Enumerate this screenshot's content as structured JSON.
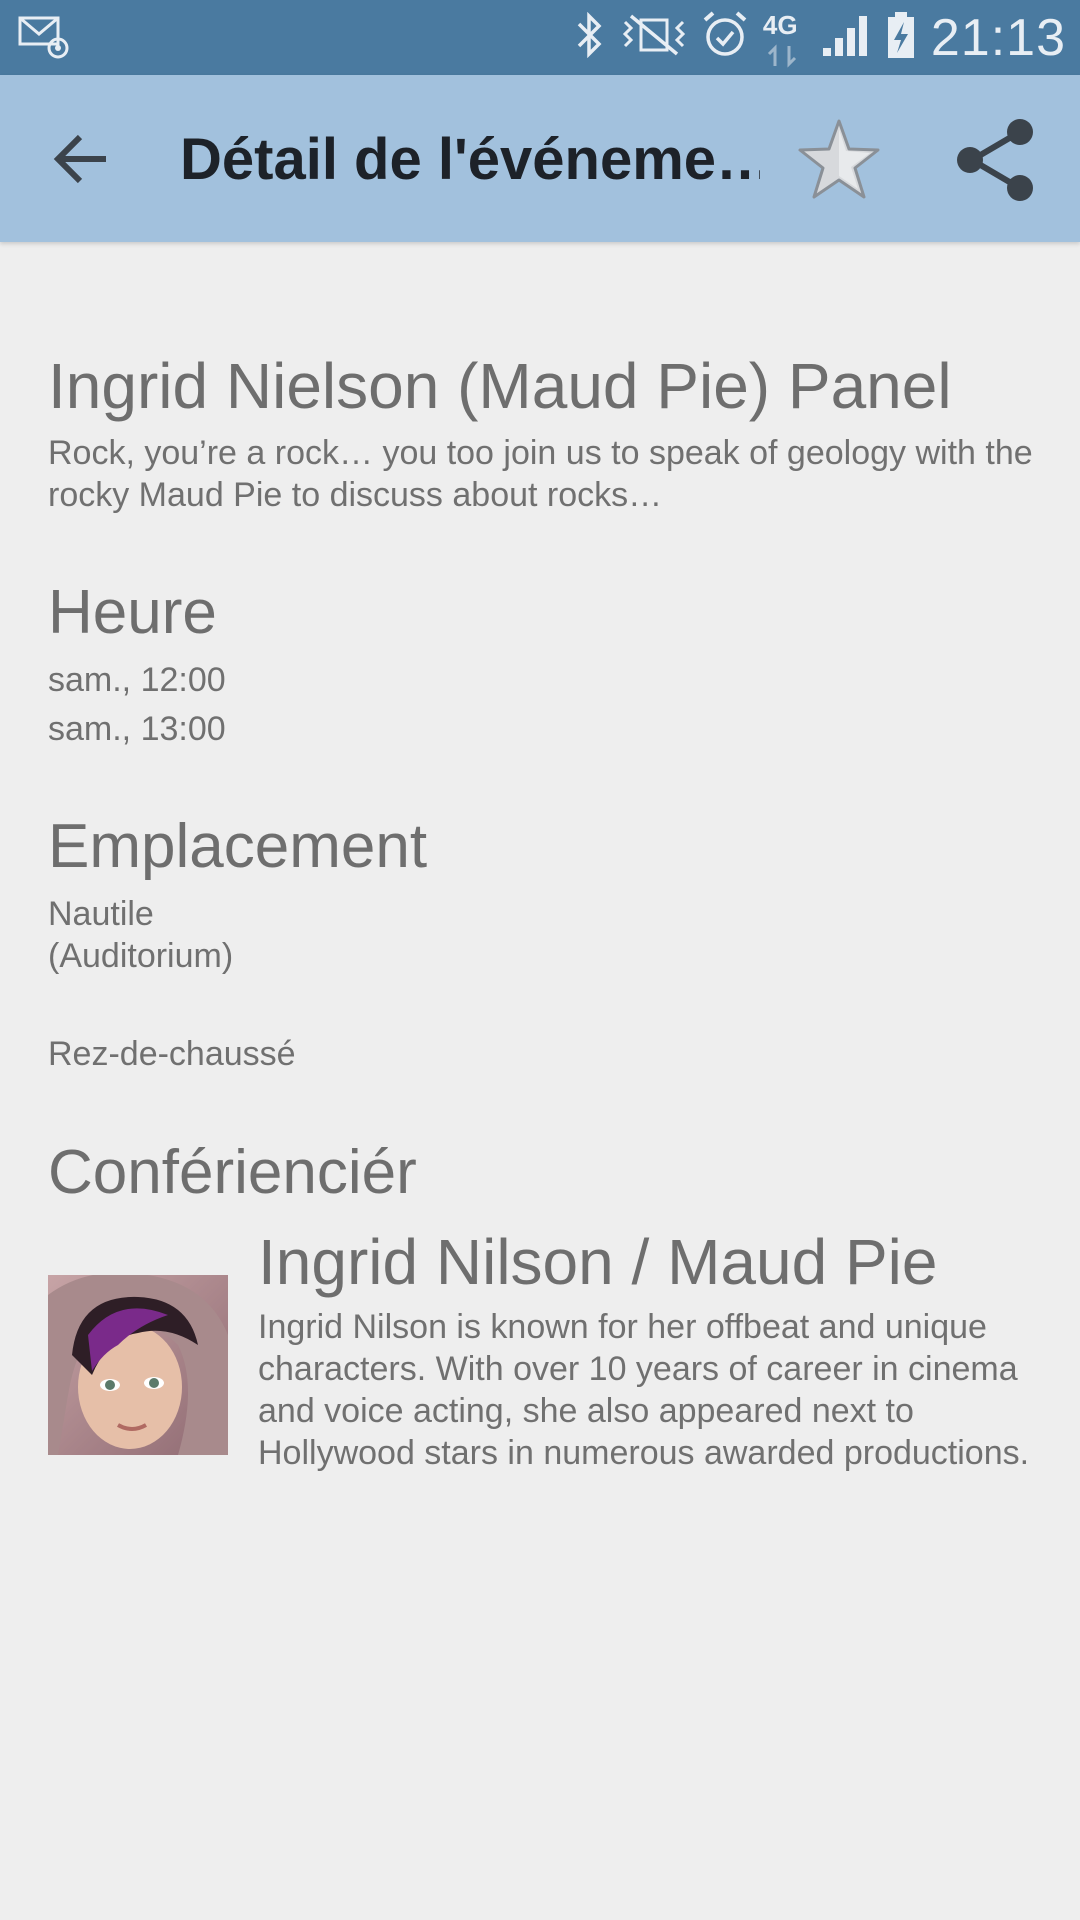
{
  "status_bar": {
    "time": "21:13",
    "network": "4G",
    "icons": [
      "email-notification-icon",
      "bluetooth-icon",
      "vibrate-icon",
      "alarm-icon",
      "network-4g-icon",
      "signal-icon",
      "battery-charging-icon"
    ]
  },
  "app_bar": {
    "title": "Détail de l'événeme…",
    "icons": [
      "back-arrow-icon",
      "star-icon",
      "share-icon"
    ]
  },
  "event": {
    "title": "Ingrid Nielson (Maud Pie) Panel",
    "description": "Rock, you’re a rock… you too join us to speak of geology with the rocky Maud Pie to discuss about rocks…"
  },
  "time_section": {
    "heading": "Heure",
    "start": "sam., 12:00",
    "end": "sam., 13:00"
  },
  "location_section": {
    "heading": "Emplacement",
    "room": "Nautile",
    "room_detail": "(Auditorium)",
    "floor": "Rez-de-chaussé"
  },
  "speaker_section": {
    "heading": "Conférienciér",
    "name": "Ingrid Nilson / Maud Pie",
    "bio": "Ingrid Nilson is known for her offbeat and unique characters. With over 10 years of career in cinema and voice acting, she also appeared next to Hollywood stars in numerous awarded productions."
  },
  "colors": {
    "status_bar": "#4a7aa0",
    "app_bar": "#a2c1dd",
    "background": "#eeeeee",
    "text": "#6f6f6f",
    "title_text": "#1d2229"
  }
}
